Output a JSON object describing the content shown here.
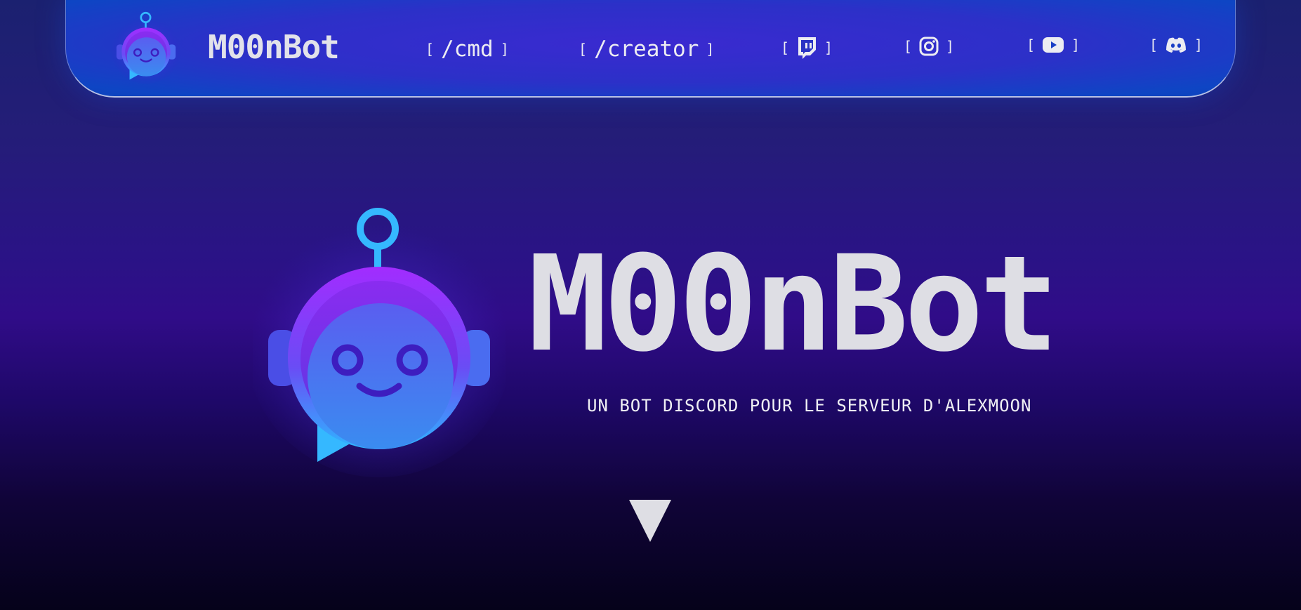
{
  "brand": {
    "name": "M00nBot",
    "colors": {
      "accent_cyan": "#35b8ff",
      "accent_purple": "#9b2cff",
      "nav_blue": "#0e45c4",
      "text": "#dedee4"
    },
    "logo_icon": "robot-chat-icon"
  },
  "nav": {
    "left_bracket": "[",
    "right_bracket": "]",
    "links": [
      {
        "label": "/cmd"
      },
      {
        "label": "/creator"
      }
    ],
    "socials": [
      {
        "icon": "twitch-icon"
      },
      {
        "icon": "instagram-icon"
      },
      {
        "icon": "youtube-icon"
      },
      {
        "icon": "discord-icon"
      }
    ]
  },
  "hero": {
    "title": "M00nBot",
    "subtitle": "UN BOT DISCORD POUR LE SERVEUR D'ALEXMOON",
    "scroll_icon": "triangle-down-icon"
  }
}
